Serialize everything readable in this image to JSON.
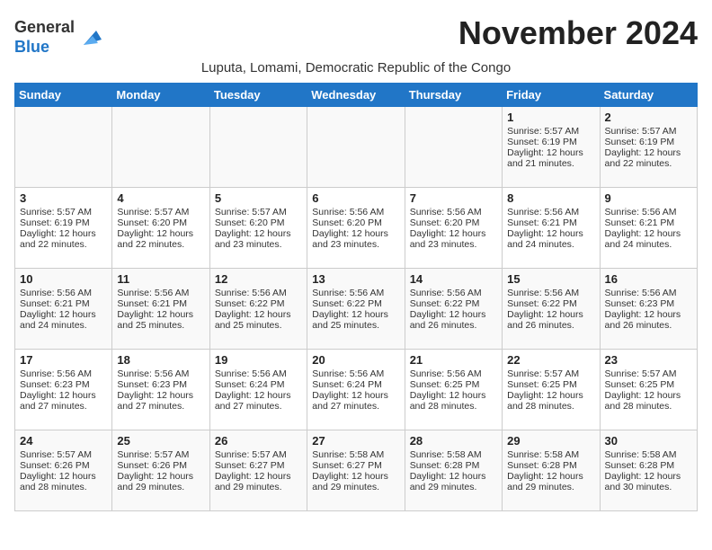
{
  "header": {
    "logo_general": "General",
    "logo_blue": "Blue",
    "month_title": "November 2024",
    "subtitle": "Luputa, Lomami, Democratic Republic of the Congo"
  },
  "days_of_week": [
    "Sunday",
    "Monday",
    "Tuesday",
    "Wednesday",
    "Thursday",
    "Friday",
    "Saturday"
  ],
  "weeks": [
    [
      {
        "day": "",
        "content": ""
      },
      {
        "day": "",
        "content": ""
      },
      {
        "day": "",
        "content": ""
      },
      {
        "day": "",
        "content": ""
      },
      {
        "day": "",
        "content": ""
      },
      {
        "day": "1",
        "content": "Sunrise: 5:57 AM\nSunset: 6:19 PM\nDaylight: 12 hours and 21 minutes."
      },
      {
        "day": "2",
        "content": "Sunrise: 5:57 AM\nSunset: 6:19 PM\nDaylight: 12 hours and 22 minutes."
      }
    ],
    [
      {
        "day": "3",
        "content": "Sunrise: 5:57 AM\nSunset: 6:19 PM\nDaylight: 12 hours and 22 minutes."
      },
      {
        "day": "4",
        "content": "Sunrise: 5:57 AM\nSunset: 6:20 PM\nDaylight: 12 hours and 22 minutes."
      },
      {
        "day": "5",
        "content": "Sunrise: 5:57 AM\nSunset: 6:20 PM\nDaylight: 12 hours and 23 minutes."
      },
      {
        "day": "6",
        "content": "Sunrise: 5:56 AM\nSunset: 6:20 PM\nDaylight: 12 hours and 23 minutes."
      },
      {
        "day": "7",
        "content": "Sunrise: 5:56 AM\nSunset: 6:20 PM\nDaylight: 12 hours and 23 minutes."
      },
      {
        "day": "8",
        "content": "Sunrise: 5:56 AM\nSunset: 6:21 PM\nDaylight: 12 hours and 24 minutes."
      },
      {
        "day": "9",
        "content": "Sunrise: 5:56 AM\nSunset: 6:21 PM\nDaylight: 12 hours and 24 minutes."
      }
    ],
    [
      {
        "day": "10",
        "content": "Sunrise: 5:56 AM\nSunset: 6:21 PM\nDaylight: 12 hours and 24 minutes."
      },
      {
        "day": "11",
        "content": "Sunrise: 5:56 AM\nSunset: 6:21 PM\nDaylight: 12 hours and 25 minutes."
      },
      {
        "day": "12",
        "content": "Sunrise: 5:56 AM\nSunset: 6:22 PM\nDaylight: 12 hours and 25 minutes."
      },
      {
        "day": "13",
        "content": "Sunrise: 5:56 AM\nSunset: 6:22 PM\nDaylight: 12 hours and 25 minutes."
      },
      {
        "day": "14",
        "content": "Sunrise: 5:56 AM\nSunset: 6:22 PM\nDaylight: 12 hours and 26 minutes."
      },
      {
        "day": "15",
        "content": "Sunrise: 5:56 AM\nSunset: 6:22 PM\nDaylight: 12 hours and 26 minutes."
      },
      {
        "day": "16",
        "content": "Sunrise: 5:56 AM\nSunset: 6:23 PM\nDaylight: 12 hours and 26 minutes."
      }
    ],
    [
      {
        "day": "17",
        "content": "Sunrise: 5:56 AM\nSunset: 6:23 PM\nDaylight: 12 hours and 27 minutes."
      },
      {
        "day": "18",
        "content": "Sunrise: 5:56 AM\nSunset: 6:23 PM\nDaylight: 12 hours and 27 minutes."
      },
      {
        "day": "19",
        "content": "Sunrise: 5:56 AM\nSunset: 6:24 PM\nDaylight: 12 hours and 27 minutes."
      },
      {
        "day": "20",
        "content": "Sunrise: 5:56 AM\nSunset: 6:24 PM\nDaylight: 12 hours and 27 minutes."
      },
      {
        "day": "21",
        "content": "Sunrise: 5:56 AM\nSunset: 6:25 PM\nDaylight: 12 hours and 28 minutes."
      },
      {
        "day": "22",
        "content": "Sunrise: 5:57 AM\nSunset: 6:25 PM\nDaylight: 12 hours and 28 minutes."
      },
      {
        "day": "23",
        "content": "Sunrise: 5:57 AM\nSunset: 6:25 PM\nDaylight: 12 hours and 28 minutes."
      }
    ],
    [
      {
        "day": "24",
        "content": "Sunrise: 5:57 AM\nSunset: 6:26 PM\nDaylight: 12 hours and 28 minutes."
      },
      {
        "day": "25",
        "content": "Sunrise: 5:57 AM\nSunset: 6:26 PM\nDaylight: 12 hours and 29 minutes."
      },
      {
        "day": "26",
        "content": "Sunrise: 5:57 AM\nSunset: 6:27 PM\nDaylight: 12 hours and 29 minutes."
      },
      {
        "day": "27",
        "content": "Sunrise: 5:58 AM\nSunset: 6:27 PM\nDaylight: 12 hours and 29 minutes."
      },
      {
        "day": "28",
        "content": "Sunrise: 5:58 AM\nSunset: 6:28 PM\nDaylight: 12 hours and 29 minutes."
      },
      {
        "day": "29",
        "content": "Sunrise: 5:58 AM\nSunset: 6:28 PM\nDaylight: 12 hours and 29 minutes."
      },
      {
        "day": "30",
        "content": "Sunrise: 5:58 AM\nSunset: 6:28 PM\nDaylight: 12 hours and 30 minutes."
      }
    ]
  ]
}
